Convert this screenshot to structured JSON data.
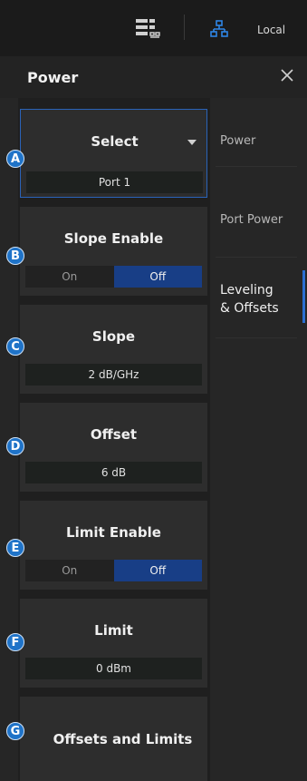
{
  "topbar": {
    "icon1": "display-link-icon",
    "icon2": "network-icon",
    "local_label": "Local"
  },
  "header": {
    "title": "Power",
    "close_icon": "close-icon"
  },
  "panels": [
    {
      "badge": "A",
      "label": "Select",
      "value": "Port 1",
      "dropdown_icon": "chevron-down-icon"
    },
    {
      "badge": "B",
      "label": "Slope Enable",
      "on": "On",
      "off": "Off",
      "selected": "Off"
    },
    {
      "badge": "C",
      "label": "Slope",
      "value": "2 dB/GHz"
    },
    {
      "badge": "D",
      "label": "Offset",
      "value": "6 dB"
    },
    {
      "badge": "E",
      "label": "Limit Enable",
      "on": "On",
      "off": "Off",
      "selected": "Off"
    },
    {
      "badge": "F",
      "label": "Limit",
      "value": "0 dBm"
    },
    {
      "badge": "G",
      "label": "Offsets and Limits"
    }
  ],
  "menu": {
    "items": [
      "Power",
      "Port Power",
      "Leveling\n& Offsets"
    ],
    "active": "Leveling\n& Offsets"
  },
  "colors": {
    "accent": "#1f73c8",
    "toggle_selected": "#183e86",
    "panel_bg": "#2d2d2d",
    "page_bg": "#262626"
  }
}
